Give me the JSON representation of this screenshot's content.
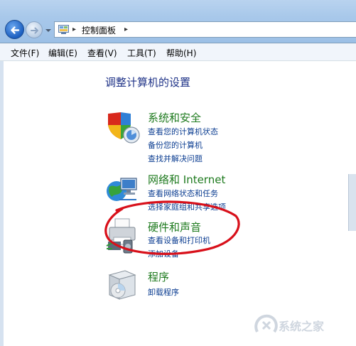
{
  "address": {
    "crumb": "控制面板",
    "separator": "▸"
  },
  "menu": [
    "文件(F)",
    "编辑(E)",
    "查看(V)",
    "工具(T)",
    "帮助(H)"
  ],
  "page_title": "调整计算机的设置",
  "categories": [
    {
      "title": "系统和安全",
      "links": [
        "查看您的计算机状态",
        "备份您的计算机",
        "查找并解决问题"
      ]
    },
    {
      "title": "网络和 Internet",
      "links": [
        "查看网络状态和任务",
        "选择家庭组和共享选项"
      ]
    },
    {
      "title": "硬件和声音",
      "links": [
        "查看设备和打印机",
        "添加设备"
      ]
    },
    {
      "title": "程序",
      "links": [
        "卸载程序"
      ]
    }
  ],
  "watermark": {
    "text": "系统之家"
  },
  "colors": {
    "category_title": "#1e7a1e",
    "link": "#0b3d91",
    "highlight_circle": "#d8101a"
  }
}
